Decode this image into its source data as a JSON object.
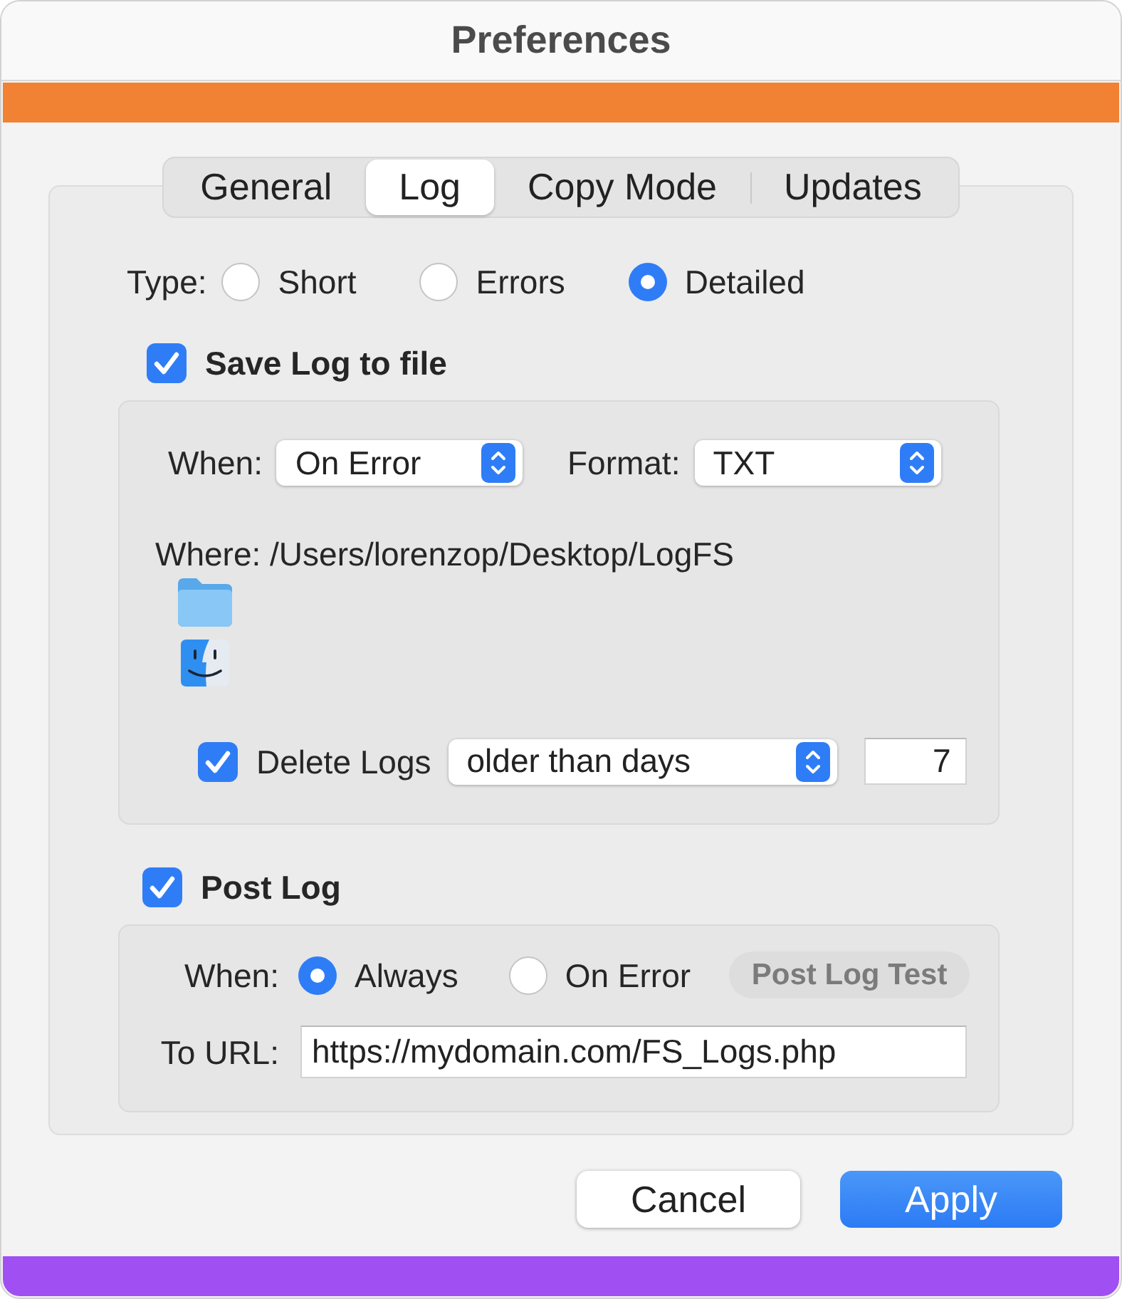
{
  "window": {
    "title": "Preferences"
  },
  "tabs": [
    {
      "label": "General",
      "selected": false
    },
    {
      "label": "Log",
      "selected": true
    },
    {
      "label": "Copy Mode",
      "selected": false
    },
    {
      "label": "Updates",
      "selected": false
    }
  ],
  "log_type": {
    "label": "Type:",
    "options": [
      {
        "label": "Short",
        "selected": false
      },
      {
        "label": "Errors",
        "selected": false
      },
      {
        "label": "Detailed",
        "selected": true
      }
    ]
  },
  "save_log": {
    "label": "Save Log to file",
    "checked": true,
    "when": {
      "label": "When:",
      "value": "On Error"
    },
    "format": {
      "label": "Format:",
      "value": "TXT"
    },
    "where": "Where: /Users/lorenzop/Desktop/LogFS",
    "delete_logs": {
      "label": "Delete Logs",
      "checked": true,
      "mode": "older than days",
      "days": "7"
    }
  },
  "post_log": {
    "label": "Post Log",
    "checked": true,
    "when": {
      "label": "When:",
      "options": [
        {
          "label": "Always",
          "selected": true
        },
        {
          "label": "On Error",
          "selected": false
        }
      ]
    },
    "test_button": {
      "label": "Post Log Test",
      "disabled": true
    },
    "url": {
      "label": "To URL:",
      "value": "https://mydomain.com/FS_Logs.php"
    }
  },
  "buttons": [
    {
      "label": "Cancel",
      "kind": "secondary"
    },
    {
      "label": "Apply",
      "kind": "primary"
    }
  ]
}
